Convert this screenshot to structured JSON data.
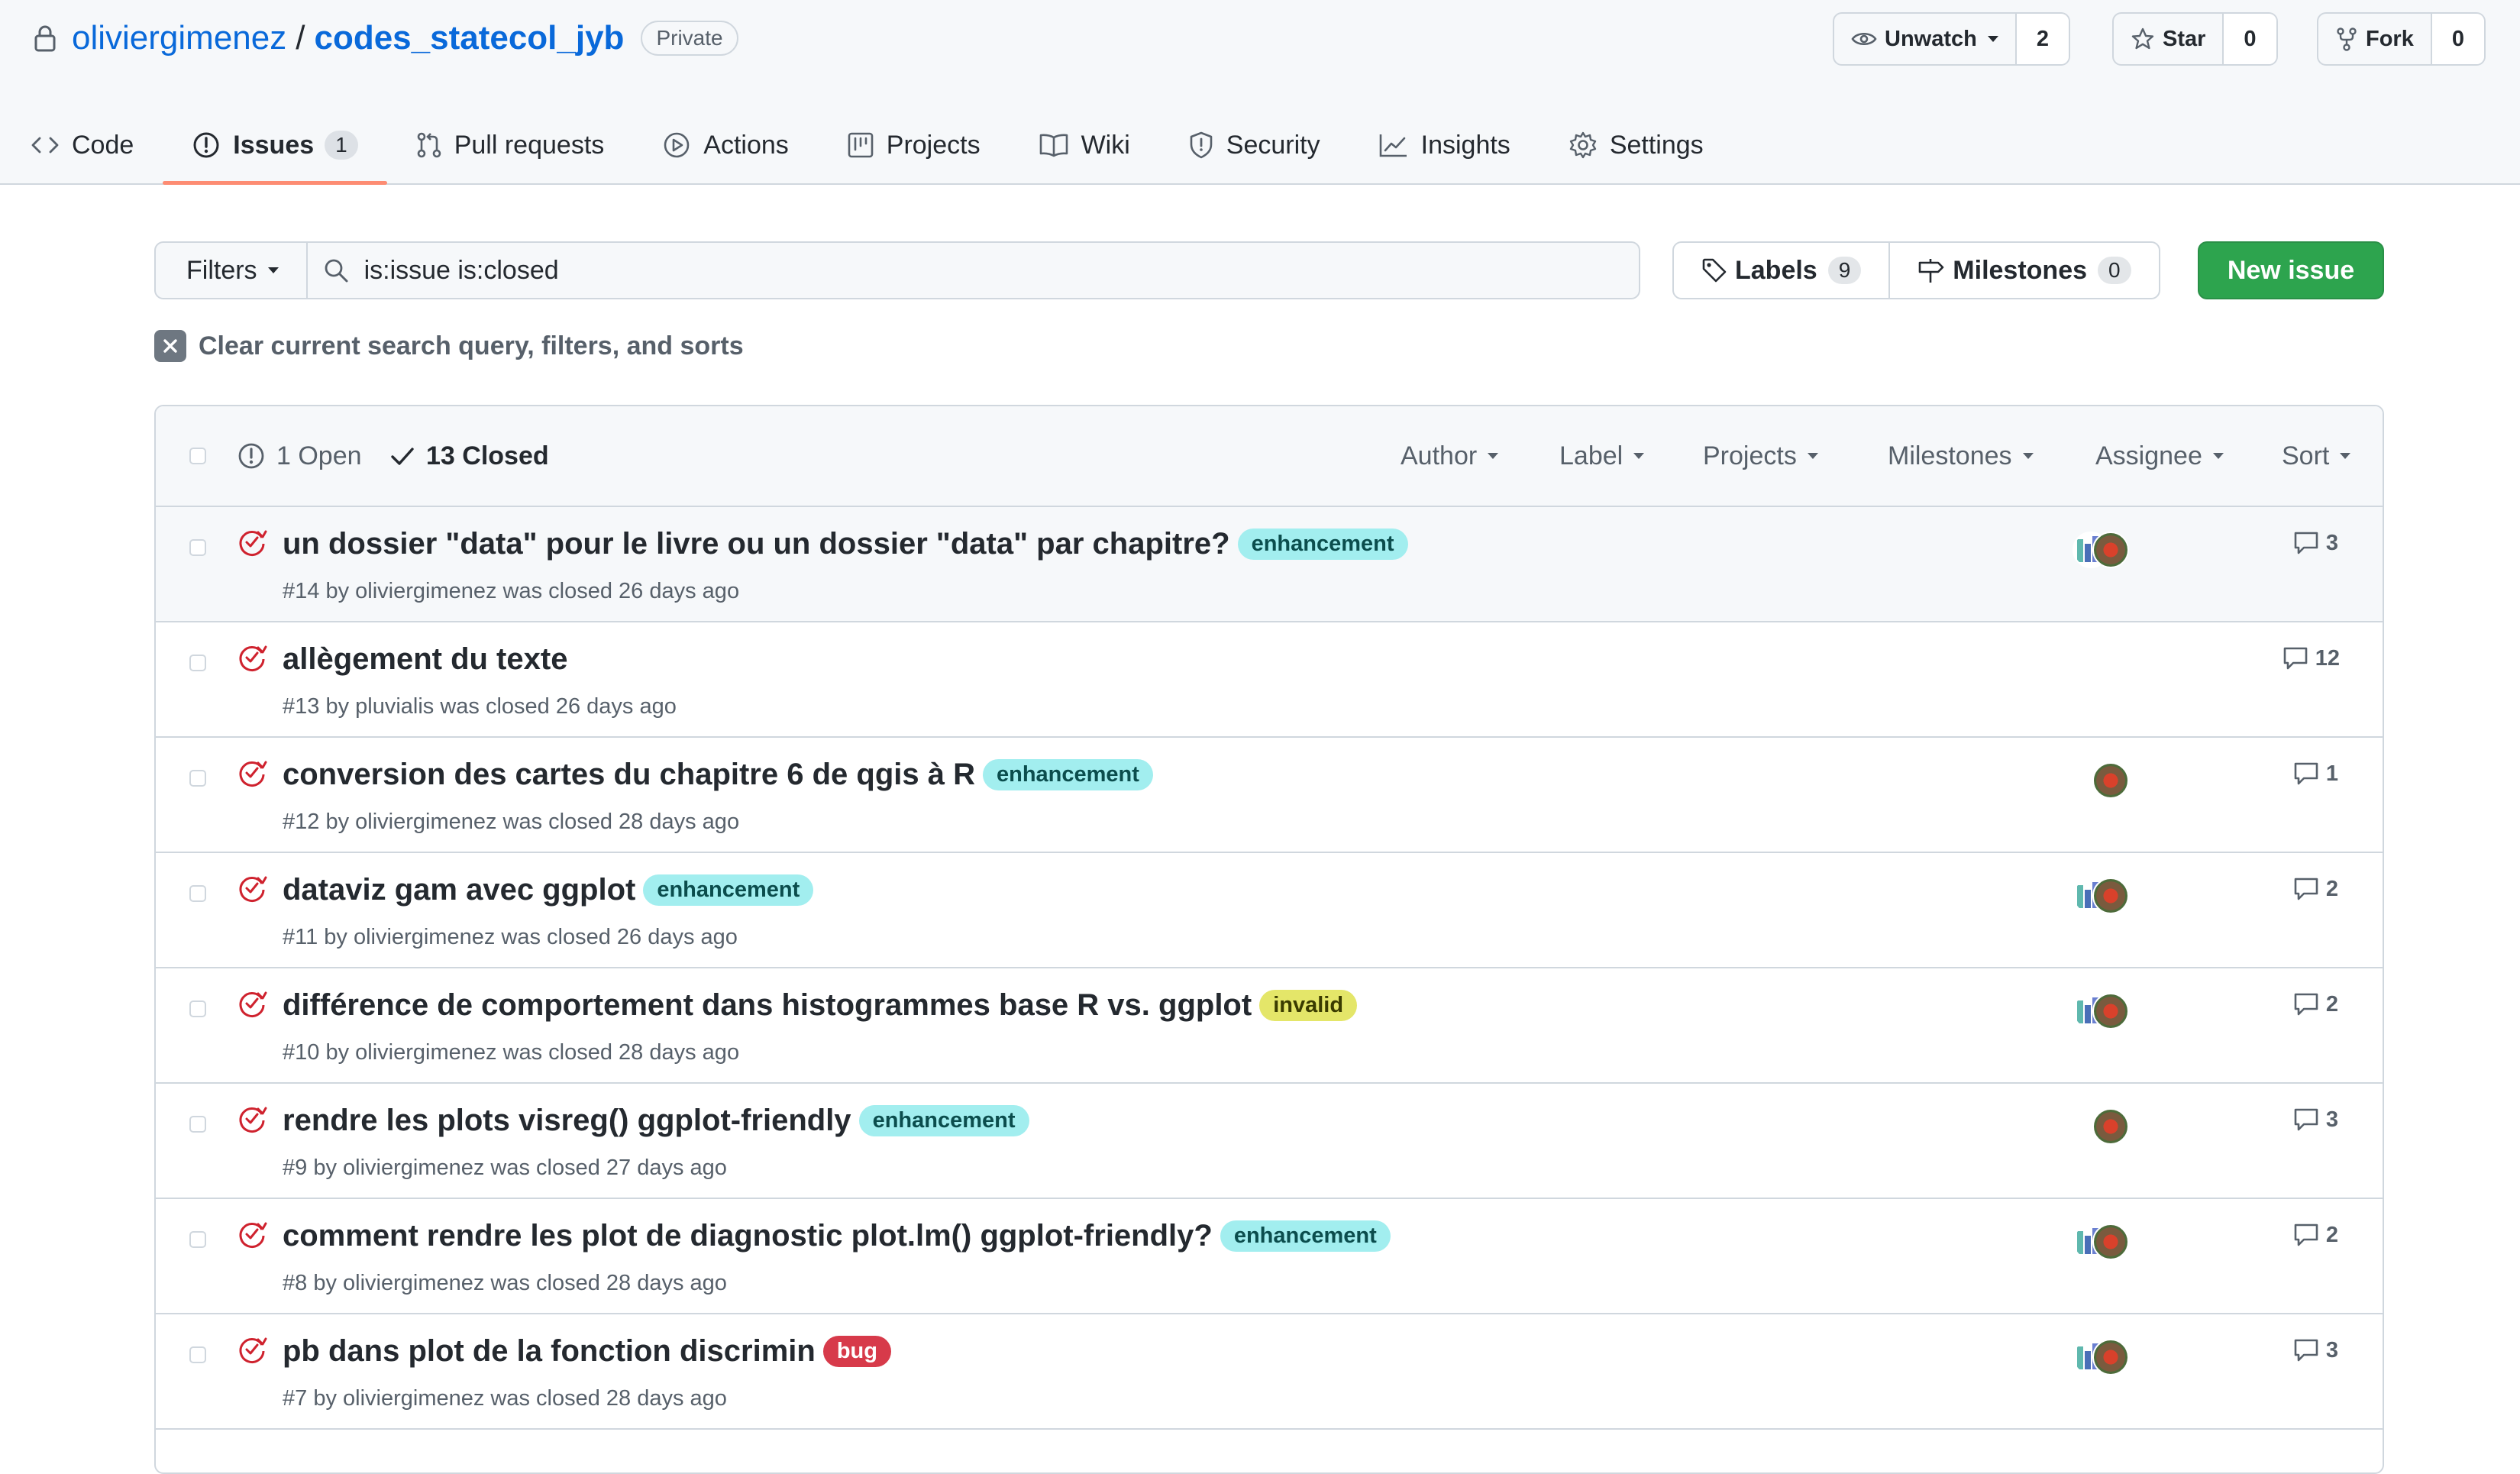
{
  "header": {
    "owner": "oliviergimenez",
    "separator": "/",
    "repo": "codes_statecol_jyb",
    "visibility": "Private",
    "watch": {
      "label": "Unwatch",
      "count": "2"
    },
    "star": {
      "label": "Star",
      "count": "0"
    },
    "fork": {
      "label": "Fork",
      "count": "0"
    }
  },
  "nav": {
    "code": "Code",
    "issues": "Issues",
    "issues_count": "1",
    "pulls": "Pull requests",
    "actions": "Actions",
    "projects": "Projects",
    "wiki": "Wiki",
    "security": "Security",
    "insights": "Insights",
    "settings": "Settings"
  },
  "subnav": {
    "filters": "Filters",
    "search_value": "is:issue is:closed",
    "labels": "Labels",
    "labels_count": "9",
    "milestones": "Milestones",
    "milestones_count": "0",
    "new_issue": "New issue",
    "clear_query": "Clear current search query, filters, and sorts"
  },
  "list_header": {
    "open": "1 Open",
    "closed": "13 Closed",
    "author": "Author",
    "label": "Label",
    "projects": "Projects",
    "milestones": "Milestones",
    "assignee": "Assignee",
    "sort": "Sort"
  },
  "label_colors": {
    "enhancement": "#a2eeef",
    "invalid": "#e4e669",
    "bug": "#d73a4a"
  },
  "issues": [
    {
      "title": "un dossier \"data\" pour le livre ou un dossier \"data\" par chapitre?",
      "label": "enhancement",
      "meta": "#14 by oliviergimenez was closed 26 days ago",
      "comments": "3"
    },
    {
      "title": "allègement du texte",
      "label": "",
      "meta": "#13 by pluvialis was closed 26 days ago",
      "comments": "12"
    },
    {
      "title": "conversion des cartes du chapitre 6 de qgis à R",
      "label": "enhancement",
      "meta": "#12 by oliviergimenez was closed 28 days ago",
      "comments": "1"
    },
    {
      "title": "dataviz gam avec ggplot",
      "label": "enhancement",
      "meta": "#11 by oliviergimenez was closed 26 days ago",
      "comments": "2"
    },
    {
      "title": "différence de comportement dans histogrammes base R vs. ggplot",
      "label": "invalid",
      "meta": "#10 by oliviergimenez was closed 28 days ago",
      "comments": "2"
    },
    {
      "title": "rendre les plots visreg() ggplot-friendly",
      "label": "enhancement",
      "meta": "#9 by oliviergimenez was closed 27 days ago",
      "comments": "3"
    },
    {
      "title": "comment rendre les plot de diagnostic plot.lm() ggplot-friendly?",
      "label": "enhancement",
      "meta": "#8 by oliviergimenez was closed 28 days ago",
      "comments": "2"
    },
    {
      "title": "pb dans plot de la fonction discrimin",
      "label": "bug",
      "meta": "#7 by oliviergimenez was closed 28 days ago",
      "comments": "3"
    }
  ]
}
